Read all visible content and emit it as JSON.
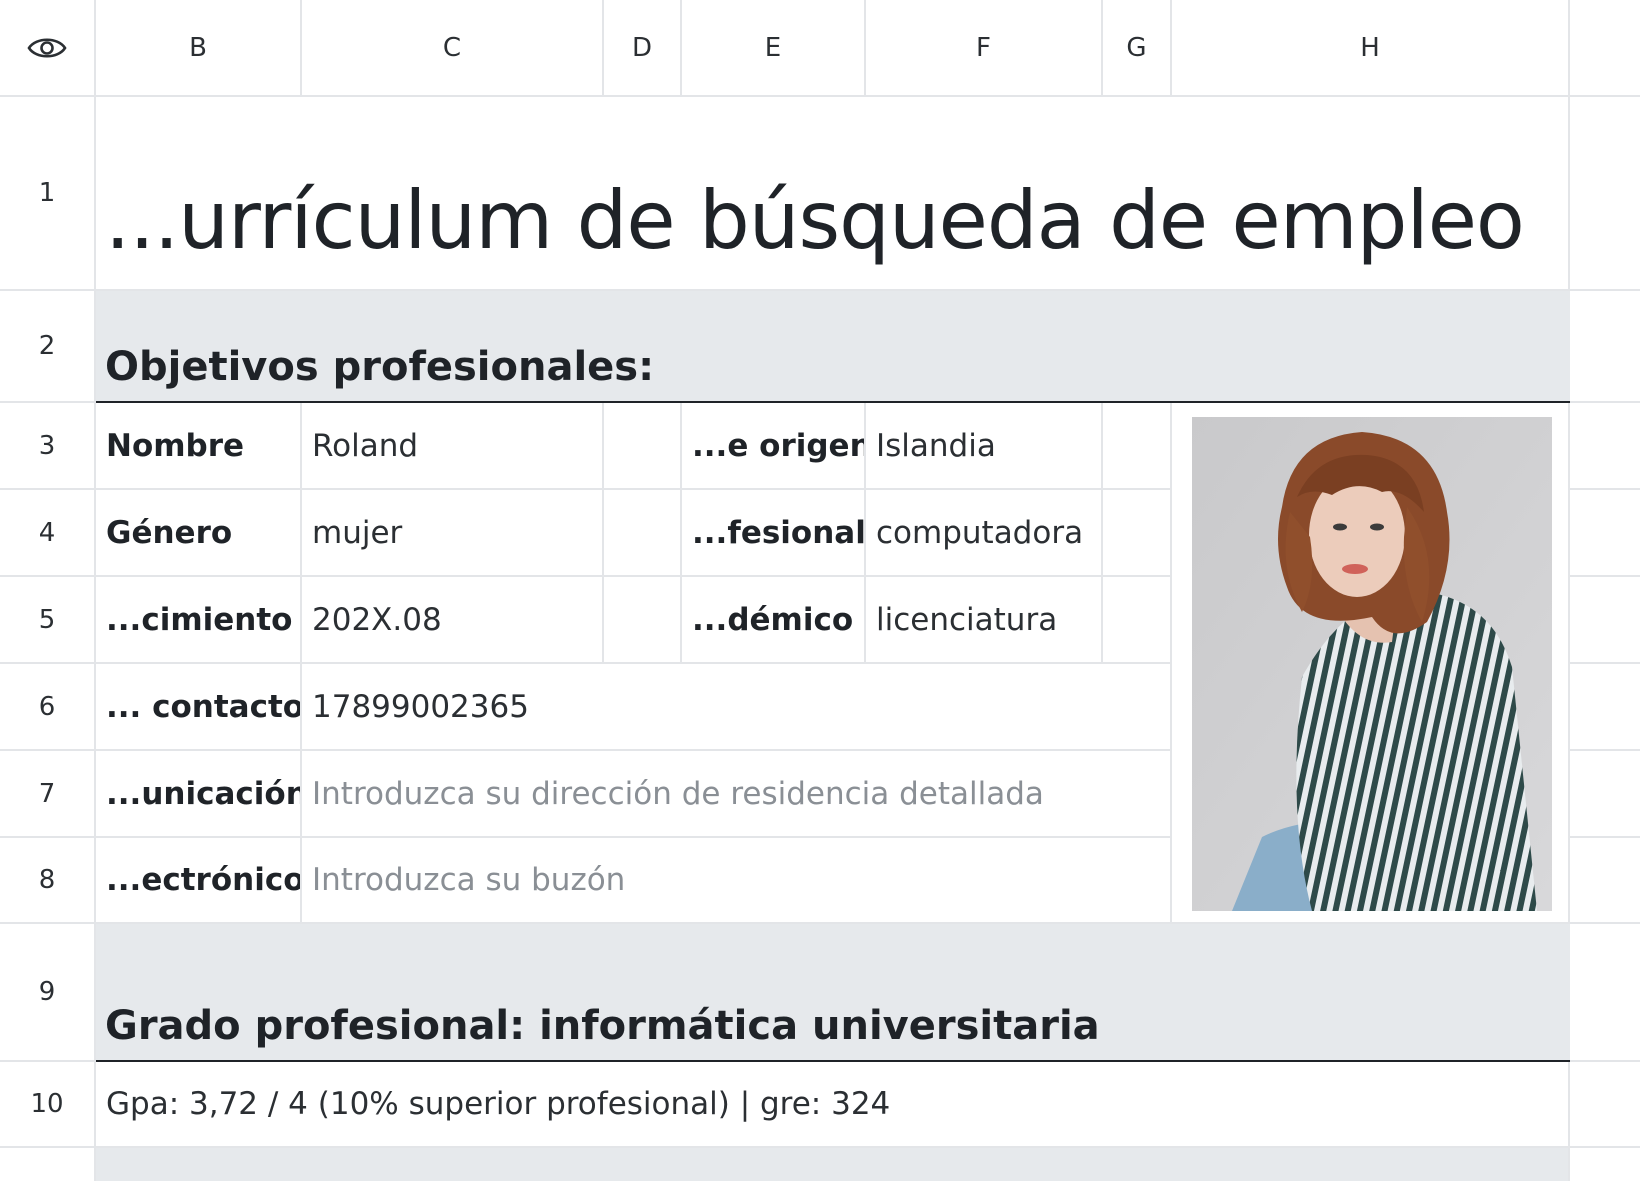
{
  "columns": [
    "B",
    "C",
    "D",
    "E",
    "F",
    "G",
    "H"
  ],
  "rows": [
    "1",
    "2",
    "3",
    "4",
    "5",
    "6",
    "7",
    "8",
    "9",
    "10"
  ],
  "title": "...urrículum de búsqueda de empleo",
  "section_objectives": "Objetivos profesionales:",
  "fields": {
    "name_label": "Nombre",
    "name_value": "Roland",
    "origin_label": "...e origen",
    "origin_value": "Islandia",
    "gender_label": "Género",
    "gender_value": "mujer",
    "profession_label": "...fesional",
    "profession_value": "computadora",
    "birth_label": "...cimiento",
    "birth_value": "202X.08",
    "academic_label": "...démico",
    "academic_value": "licenciatura",
    "contact_label": "... contacto",
    "contact_value": "17899002365",
    "address_label": "...unicación",
    "address_placeholder": "Introduzca su dirección de residencia detallada",
    "email_label": "...ectrónico",
    "email_placeholder": "Introduzca su buzón"
  },
  "section_degree": "Grado profesional: informática universitaria",
  "gpa_line": "Gpa: 3,72 / 4 (10% superior profesional) | gre: 324",
  "icons": {
    "visibility": "eye-icon",
    "photo": "profile-photo"
  }
}
